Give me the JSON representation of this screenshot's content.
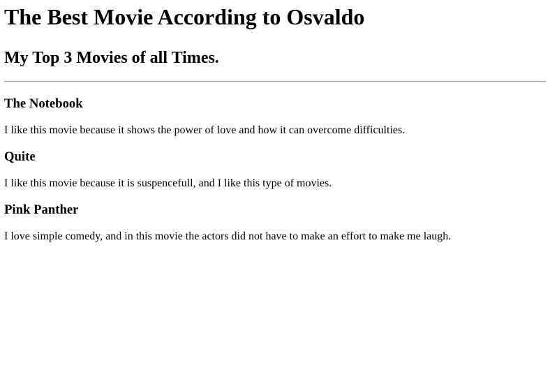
{
  "header": {
    "title": "The Best Movie According to Osvaldo",
    "subtitle": "My Top 3 Movies of all Times."
  },
  "movies": [
    {
      "title": "The Notebook",
      "description": "I like this movie because it shows the power of love and how it can overcome difficulties."
    },
    {
      "title": "Quite",
      "description": "I like this movie because it is suspencefull, and I like this type of movies."
    },
    {
      "title": "Pink Panther",
      "description": "I love simple comedy, and in this movie the actors did not have to make an effort to make me laugh."
    }
  ]
}
